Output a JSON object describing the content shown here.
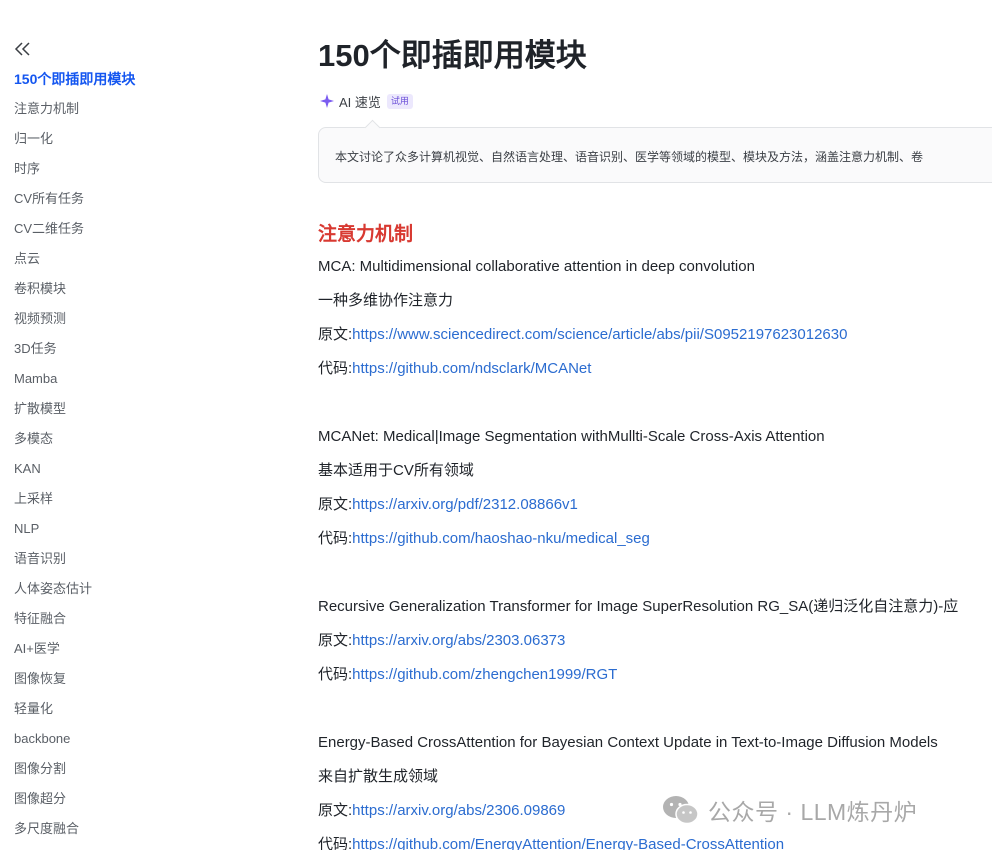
{
  "sidebar": {
    "items": [
      {
        "label": "150个即插即用模块"
      },
      {
        "label": "注意力机制"
      },
      {
        "label": "归一化"
      },
      {
        "label": "时序"
      },
      {
        "label": "CV所有任务"
      },
      {
        "label": "CV二维任务"
      },
      {
        "label": "点云"
      },
      {
        "label": "卷积模块"
      },
      {
        "label": "视频预测"
      },
      {
        "label": "3D任务"
      },
      {
        "label": "Mamba"
      },
      {
        "label": "扩散模型"
      },
      {
        "label": "多模态"
      },
      {
        "label": "KAN"
      },
      {
        "label": "上采样"
      },
      {
        "label": "NLP"
      },
      {
        "label": "语音识别"
      },
      {
        "label": "人体姿态估计"
      },
      {
        "label": "特征融合"
      },
      {
        "label": "AI+医学"
      },
      {
        "label": "图像恢复"
      },
      {
        "label": "轻量化"
      },
      {
        "label": "backbone"
      },
      {
        "label": "图像分割"
      },
      {
        "label": "图像超分"
      },
      {
        "label": "多尺度融合"
      }
    ]
  },
  "doc": {
    "title": "150个即插即用模块",
    "ai_label": "AI 速览",
    "ai_badge": "试用",
    "summary": "本文讨论了众多计算机视觉、自然语言处理、语音识别、医学等领域的模型、模块及方法，涵盖注意力机制、卷",
    "section_heading": "注意力机制",
    "entries": [
      {
        "title": "MCA: Multidimensional collaborative attention in deep convolution",
        "desc": "一种多维协作注意力",
        "paper_prefix": "原文:",
        "paper_url": "https://www.sciencedirect.com/science/article/abs/pii/S0952197623012630",
        "code_prefix": "代码:",
        "code_url": "https://github.com/ndsclark/MCANet"
      },
      {
        "title": "MCANet: Medical|Image Segmentation withMullti-Scale Cross-Axis Attention",
        "desc": "基本适用于CV所有领域",
        "paper_prefix": "原文:",
        "paper_url": "https://arxiv.org/pdf/2312.08866v1",
        "code_prefix": "代码:",
        "code_url": "https://github.com/haoshao-nku/medical_seg"
      },
      {
        "title": "Recursive Generalization Transformer for Image SuperResolution RG_SA(递归泛化自注意力)-应",
        "paper_prefix": "原文:",
        "paper_url": "https://arxiv.org/abs/2303.06373",
        "code_prefix": "代码:",
        "code_url": "https://github.com/zhengchen1999/RGT"
      },
      {
        "title": "Energy-Based CrossAttention for Bayesian Context Update in Text-to-Image Diffusion Models",
        "desc": "来自扩散生成领域",
        "paper_prefix": "原文:",
        "paper_url": "https://arxiv.org/abs/2306.09869",
        "code_prefix": "代码:",
        "code_url": "https://github.com/EnergyAttention/Energy-Based-CrossAttention"
      }
    ]
  },
  "watermark": {
    "text": "公众号 · LLM炼丹炉"
  },
  "colors": {
    "accent": "#1456f0",
    "heading_red": "#d83931",
    "link": "#2b6cd0"
  }
}
